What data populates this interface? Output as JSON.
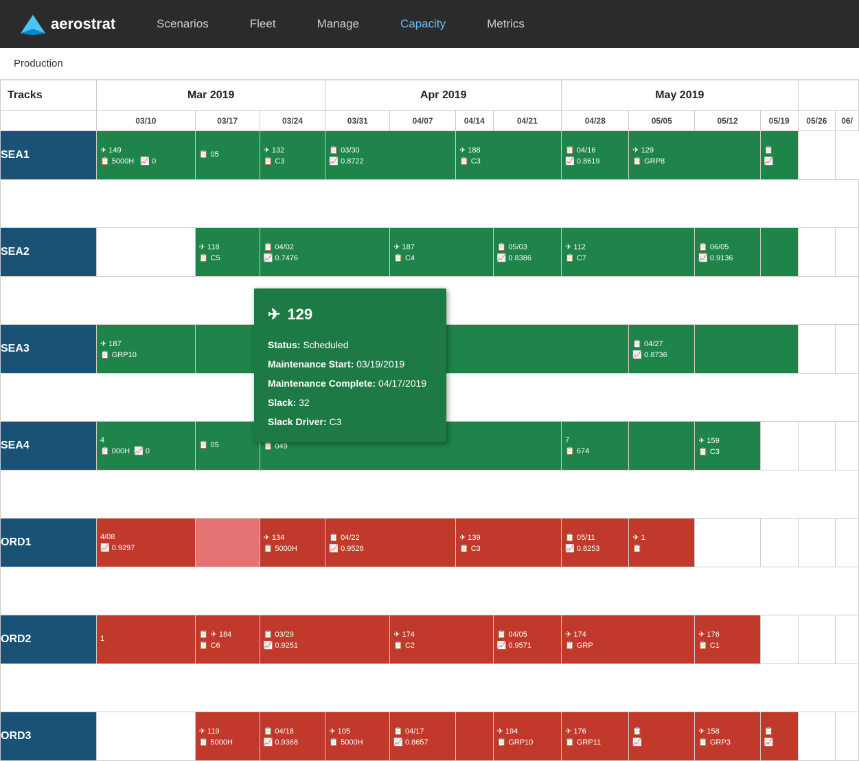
{
  "nav": {
    "logo_text": "aerostrat",
    "links": [
      {
        "label": "Scenarios",
        "active": false
      },
      {
        "label": "Fleet",
        "active": false
      },
      {
        "label": "Manage",
        "active": false
      },
      {
        "label": "Capacity",
        "active": true
      },
      {
        "label": "Metrics",
        "active": false
      }
    ]
  },
  "breadcrumb": "Production",
  "schedule": {
    "tracks_label": "Tracks",
    "months": [
      {
        "label": "Mar 2019",
        "colspan": 3
      },
      {
        "label": "Apr 2019",
        "colspan": 4
      },
      {
        "label": "May 2019",
        "colspan": 4
      }
    ],
    "weeks": [
      "03/10",
      "03/17",
      "03/24",
      "03/31",
      "04/07",
      "04/14",
      "04/21",
      "04/28",
      "05/05",
      "05/12",
      "05/19",
      "05/26",
      "06/"
    ],
    "rows": [
      {
        "track": "SEA1",
        "color": "blue",
        "blocks": [
          {
            "type": "green",
            "row1": "✈ 149",
            "row2": "📋 5000H  📈 0"
          },
          {
            "type": "green",
            "row1": "📋 05",
            "row2": ""
          },
          {
            "type": "green",
            "row1": "✈ 132",
            "row2": "📋 C3"
          },
          {
            "type": "green",
            "row1": "📋 03/30",
            "row2": "📈 0.8722"
          },
          {
            "type": "green",
            "row1": "",
            "row2": ""
          },
          {
            "type": "green",
            "row1": "✈ 188",
            "row2": "📋 C3"
          },
          {
            "type": "green",
            "row1": "📋 04/16",
            "row2": "📈 0.8619"
          },
          {
            "type": "green",
            "row1": "",
            "row2": ""
          },
          {
            "type": "green",
            "row1": "✈ 129",
            "row2": "📋 GRP8"
          },
          {
            "type": "green",
            "row1": "📋",
            "row2": "📈"
          },
          {
            "type": "empty"
          },
          {
            "type": "empty"
          },
          {
            "type": "empty"
          }
        ]
      },
      {
        "track": "SEA2",
        "color": "blue",
        "blocks": [
          {
            "type": "empty"
          },
          {
            "type": "green",
            "row1": "✈ 118",
            "row2": "📋 C5"
          },
          {
            "type": "green",
            "row1": "📋 04/02",
            "row2": "📈 0.7476"
          },
          {
            "type": "green",
            "row1": "",
            "row2": ""
          },
          {
            "type": "green",
            "row1": "✈ 187",
            "row2": "📋 C4"
          },
          {
            "type": "green",
            "row1": "📋 05/03",
            "row2": "📈 0.8386"
          },
          {
            "type": "green",
            "row1": "",
            "row2": ""
          },
          {
            "type": "green",
            "row1": "✈ 112",
            "row2": "📋 C7"
          },
          {
            "type": "green",
            "row1": "📋 06/05",
            "row2": "📈 0.9136"
          },
          {
            "type": "green",
            "row1": "",
            "row2": ""
          },
          {
            "type": "empty"
          },
          {
            "type": "empty"
          },
          {
            "type": "empty"
          }
        ]
      },
      {
        "track": "SEA3",
        "color": "blue",
        "blocks": [
          {
            "type": "green",
            "row1": "✈ 187",
            "row2": "📋 GRP10"
          },
          {
            "type": "green",
            "row1": "",
            "row2": ""
          },
          {
            "type": "green",
            "row1": "",
            "row2": ""
          },
          {
            "type": "green",
            "row1": "",
            "row2": ""
          },
          {
            "type": "green",
            "row1": "",
            "row2": ""
          },
          {
            "type": "green",
            "row1": "",
            "row2": ""
          },
          {
            "type": "green",
            "row1": "",
            "row2": ""
          },
          {
            "type": "green",
            "row1": "📋 04/27",
            "row2": "📈 0.8736"
          },
          {
            "type": "green",
            "row1": "",
            "row2": ""
          },
          {
            "type": "green",
            "row1": "",
            "row2": ""
          },
          {
            "type": "empty"
          },
          {
            "type": "empty"
          },
          {
            "type": "empty"
          }
        ]
      },
      {
        "track": "SEA4",
        "color": "blue",
        "blocks": [
          {
            "type": "green",
            "row1": "4",
            "row2": "📋 000H  📈 0"
          },
          {
            "type": "green",
            "row1": "📋 05",
            "row2": ""
          },
          {
            "type": "green",
            "row1": "",
            "row2": "📋 049"
          },
          {
            "type": "green",
            "row1": "",
            "row2": ""
          },
          {
            "type": "green",
            "row1": "",
            "row2": ""
          },
          {
            "type": "green",
            "row1": "",
            "row2": ""
          },
          {
            "type": "green",
            "row1": "7",
            "row2": "📋 674"
          },
          {
            "type": "green",
            "row1": "",
            "row2": ""
          },
          {
            "type": "green",
            "row1": "✈ 159",
            "row2": "📋 C3"
          },
          {
            "type": "empty"
          },
          {
            "type": "empty"
          },
          {
            "type": "empty"
          },
          {
            "type": "empty"
          }
        ]
      },
      {
        "track": "ORD1",
        "color": "blue",
        "blocks": [
          {
            "type": "red",
            "row1": "4/08",
            "row2": "📈 0.9297"
          },
          {
            "type": "red-light",
            "row1": "",
            "row2": ""
          },
          {
            "type": "red",
            "row1": "✈ 134",
            "row2": "📋 5000H"
          },
          {
            "type": "red",
            "row1": "📋 04/22",
            "row2": "📈 0.9526"
          },
          {
            "type": "red",
            "row1": "",
            "row2": ""
          },
          {
            "type": "red",
            "row1": "✈ 139",
            "row2": "📋 C3"
          },
          {
            "type": "red",
            "row1": "📋 05/11",
            "row2": "📈 0.8253"
          },
          {
            "type": "red",
            "row1": "",
            "row2": ""
          },
          {
            "type": "red",
            "row1": "✈ 1",
            "row2": "📋"
          },
          {
            "type": "empty"
          },
          {
            "type": "empty"
          },
          {
            "type": "empty"
          },
          {
            "type": "empty"
          }
        ]
      },
      {
        "track": "ORD2",
        "color": "blue",
        "blocks": [
          {
            "type": "red",
            "row1": "1",
            "row2": ""
          },
          {
            "type": "red",
            "row1": "📋  ✈ 184",
            "row2": "📋 C6"
          },
          {
            "type": "red",
            "row1": "📋 03/29",
            "row2": "📈 0.9251"
          },
          {
            "type": "red",
            "row1": "",
            "row2": ""
          },
          {
            "type": "red",
            "row1": "✈ 174",
            "row2": "📋 C2"
          },
          {
            "type": "red",
            "row1": "📋 04/05",
            "row2": "📈 0.9571"
          },
          {
            "type": "red",
            "row1": "",
            "row2": ""
          },
          {
            "type": "red",
            "row1": "✈ 174",
            "row2": "📋 GRP"
          },
          {
            "type": "red",
            "row1": "✈ 176",
            "row2": "📋 C1"
          },
          {
            "type": "empty"
          },
          {
            "type": "empty"
          },
          {
            "type": "empty"
          },
          {
            "type": "empty"
          }
        ]
      },
      {
        "track": "ORD3",
        "color": "blue",
        "blocks": [
          {
            "type": "empty"
          },
          {
            "type": "red",
            "row1": "✈ 119",
            "row2": "📋 5000H"
          },
          {
            "type": "red",
            "row1": "📋 04/18",
            "row2": "📈 0.9368"
          },
          {
            "type": "red",
            "row1": "✈ 105",
            "row2": "📋 5000H"
          },
          {
            "type": "red",
            "row1": "📋 04/17",
            "row2": "📈 0.8657"
          },
          {
            "type": "red",
            "row1": "",
            "row2": ""
          },
          {
            "type": "red",
            "row1": "✈ 194",
            "row2": "📋 GRP10"
          },
          {
            "type": "red",
            "row1": "✈ 176",
            "row2": "📋 GRP11"
          },
          {
            "type": "red",
            "row1": "📋",
            "row2": "📈"
          },
          {
            "type": "red",
            "row1": "✈ 158",
            "row2": "📋 GRP3"
          },
          {
            "type": "red",
            "row1": "📋",
            "row2": "📈"
          },
          {
            "type": "empty"
          },
          {
            "type": "empty"
          }
        ]
      }
    ]
  },
  "tooltip": {
    "plane_number": "129",
    "status_label": "Status:",
    "status_value": "Scheduled",
    "maint_start_label": "Maintenance Start:",
    "maint_start_value": "03/19/2019",
    "maint_complete_label": "Maintenance Complete:",
    "maint_complete_value": "04/17/2019",
    "slack_label": "Slack:",
    "slack_value": "32",
    "slack_driver_label": "Slack Driver:",
    "slack_driver_value": "C3"
  }
}
